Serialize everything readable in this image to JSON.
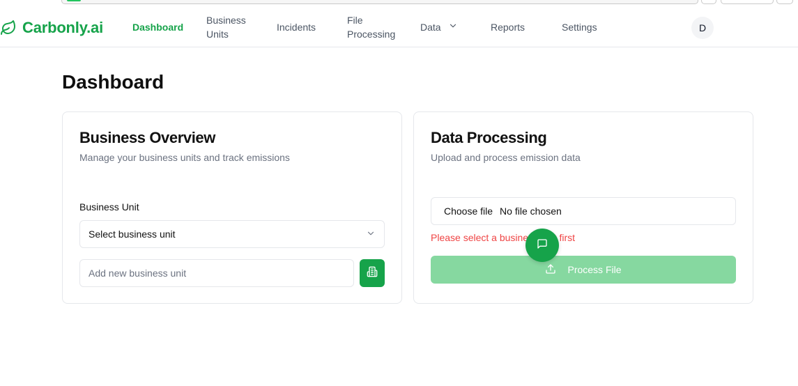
{
  "app": {
    "name": "Carbonly.ai",
    "brand_color": "#16a34a"
  },
  "nav": {
    "items": [
      {
        "label": "Dashboard",
        "active": true
      },
      {
        "label_line1": "Business",
        "label_line2": "Units"
      },
      {
        "label": "Incidents"
      },
      {
        "label_line1": "File",
        "label_line2": "Processing"
      },
      {
        "label": "Data",
        "has_dropdown": true
      },
      {
        "label": "Reports"
      },
      {
        "label": "Settings"
      }
    ],
    "avatar_initial": "D"
  },
  "page": {
    "title": "Dashboard"
  },
  "business_overview": {
    "title": "Business Overview",
    "subtitle": "Manage your business units and track emissions",
    "field_label": "Business Unit",
    "select_value": "Select business unit",
    "new_unit_placeholder": "Add new business unit",
    "add_icon": "building-icon"
  },
  "data_processing": {
    "title": "Data Processing",
    "subtitle": "Upload and process emission data",
    "choose_file_label": "Choose file",
    "file_status": "No file chosen",
    "error_message": "Please select a business unit first",
    "process_button_label": "Process File",
    "process_icon": "upload-icon",
    "error_color": "#ef4444"
  },
  "chat": {
    "icon": "chat-icon"
  }
}
